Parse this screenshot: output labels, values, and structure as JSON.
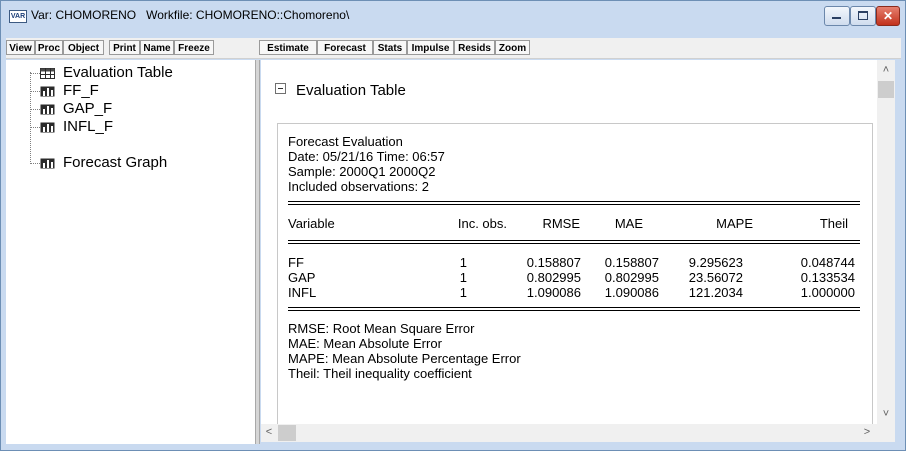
{
  "window": {
    "icon_text": "VAR",
    "title": "Var: CHOMORENO   Workfile: CHOMORENO::Chomoreno\\",
    "buttons": {
      "minimize_icon": "minimize-icon",
      "maximize_icon": "maximize-icon",
      "close_icon": "close-icon",
      "close_glyph": "✕"
    }
  },
  "toolbar": {
    "buttons": [
      "View",
      "Proc",
      "Object",
      "Print",
      "Name",
      "Freeze",
      "Estimate",
      "Forecast",
      "Stats",
      "Impulse",
      "Resids",
      "Zoom"
    ]
  },
  "tree": {
    "items": [
      {
        "label": "Evaluation Table",
        "icon": "table-icon"
      },
      {
        "label": "FF_F",
        "icon": "graph-icon"
      },
      {
        "label": "GAP_F",
        "icon": "graph-icon"
      },
      {
        "label": "INFL_F",
        "icon": "graph-icon"
      },
      {
        "label": "Forecast Graph",
        "icon": "graph-icon"
      }
    ]
  },
  "content": {
    "section_title": "Evaluation Table",
    "header_lines": [
      "Forecast Evaluation",
      "Date: 05/21/16   Time: 06:57",
      "Sample: 2000Q1 2000Q2",
      "Included observations: 2"
    ],
    "table": {
      "columns": [
        "Variable",
        "Inc. obs.",
        "RMSE",
        "MAE",
        "MAPE",
        "Theil"
      ],
      "rows": [
        [
          "FF",
          "1",
          "0.158807",
          "0.158807",
          "9.295623",
          "0.048744"
        ],
        [
          "GAP",
          "1",
          "0.802995",
          "0.802995",
          "23.56072",
          "0.133534"
        ],
        [
          "INFL",
          "1",
          "1.090086",
          "1.090086",
          "121.2034",
          "1.000000"
        ]
      ]
    },
    "legend_lines": [
      "RMSE:  Root Mean Square Error",
      "MAE:  Mean Absolute Error",
      "MAPE:  Mean Absolute Percentage Error",
      "Theil:  Theil inequality coefficient"
    ]
  },
  "scrollbars": {
    "up": "˄",
    "down": "˅",
    "left": "<",
    "right": ">"
  },
  "colors": {
    "titlebar": "#c9daf0",
    "close_button": "#c2321d"
  }
}
